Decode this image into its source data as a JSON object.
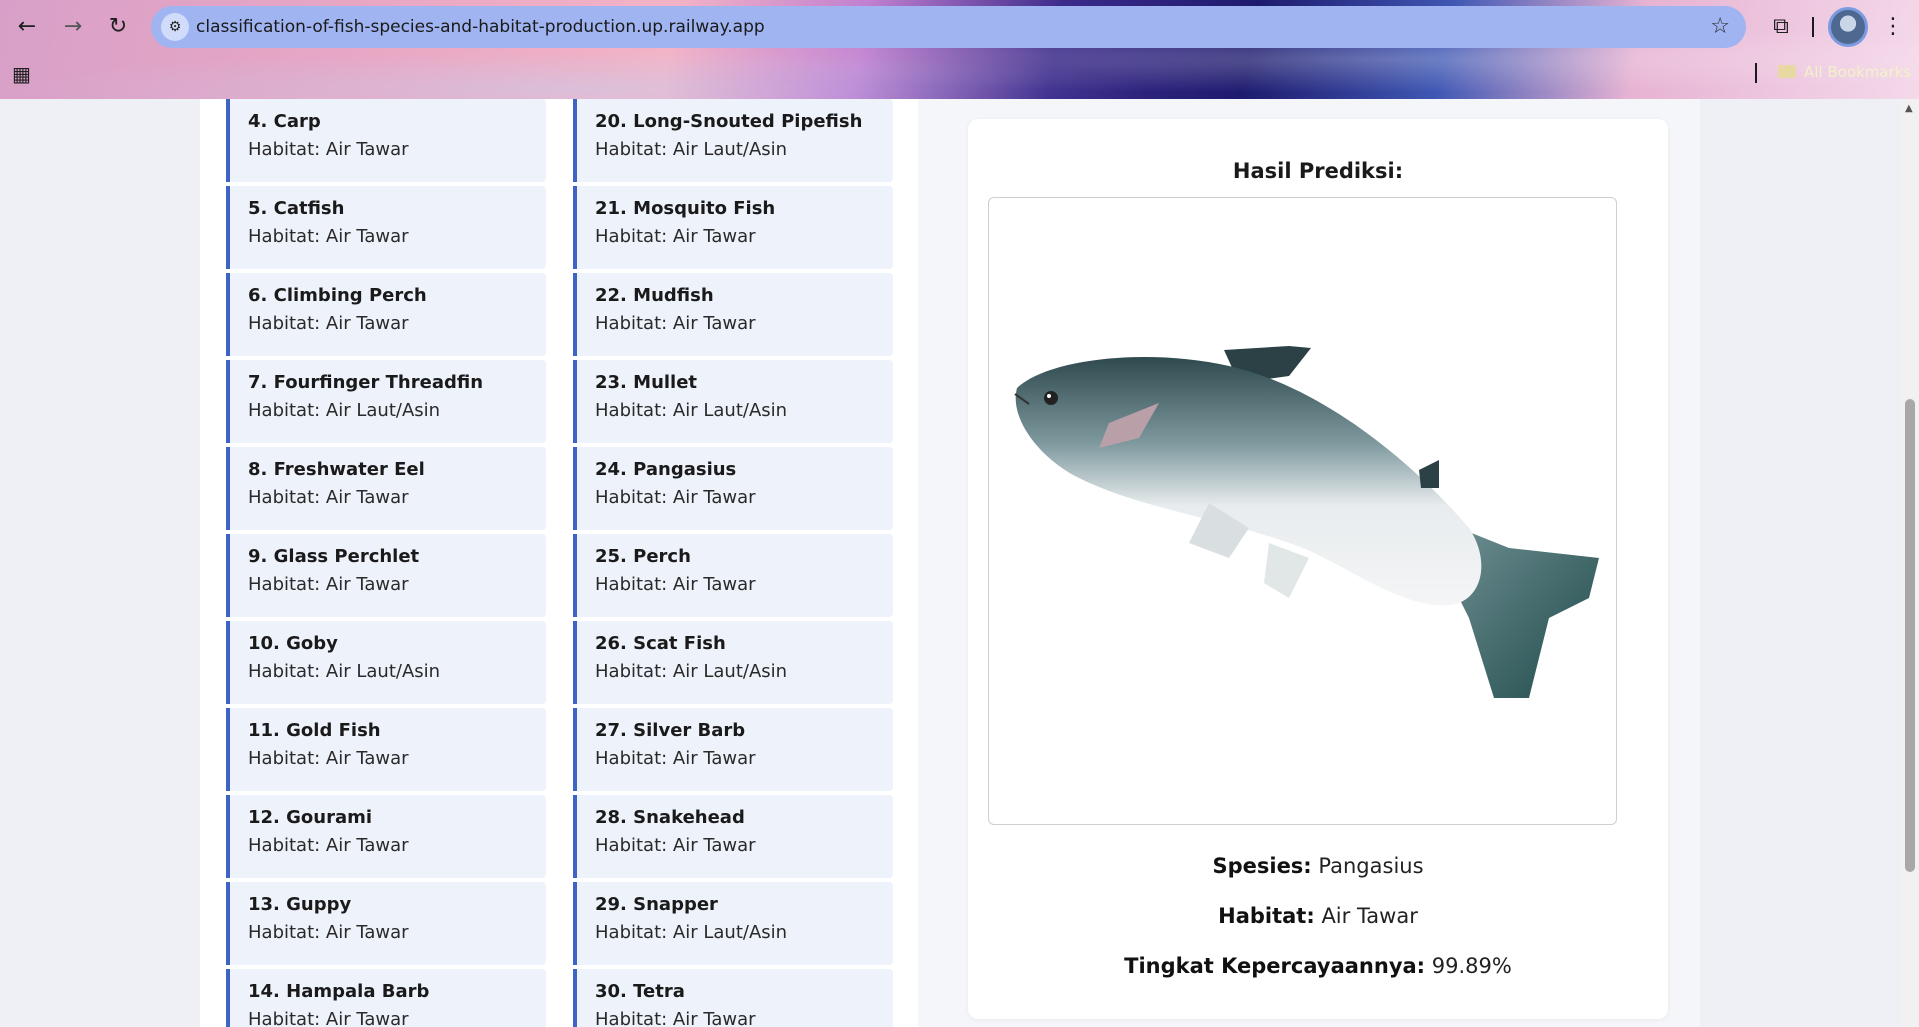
{
  "browser": {
    "url": "classification-of-fish-species-and-habitat-production.up.railway.app",
    "bookmarks_label": "All Bookmarks"
  },
  "fish_list": {
    "col_a": [
      {
        "name": "4. Carp",
        "habitat": "Habitat: Air Tawar"
      },
      {
        "name": "5. Catfish",
        "habitat": "Habitat: Air Tawar"
      },
      {
        "name": "6. Climbing Perch",
        "habitat": "Habitat: Air Tawar"
      },
      {
        "name": "7. Fourfinger Threadfin",
        "habitat": "Habitat: Air Laut/Asin"
      },
      {
        "name": "8. Freshwater Eel",
        "habitat": "Habitat: Air Tawar"
      },
      {
        "name": "9. Glass Perchlet",
        "habitat": "Habitat: Air Tawar"
      },
      {
        "name": "10. Goby",
        "habitat": "Habitat: Air Laut/Asin"
      },
      {
        "name": "11. Gold Fish",
        "habitat": "Habitat: Air Tawar"
      },
      {
        "name": "12. Gourami",
        "habitat": "Habitat: Air Tawar"
      },
      {
        "name": "13. Guppy",
        "habitat": "Habitat: Air Tawar"
      },
      {
        "name": "14. Hampala Barb",
        "habitat": "Habitat: Air Tawar"
      }
    ],
    "col_b": [
      {
        "name": "20. Long-Snouted Pipefish",
        "habitat": "Habitat: Air Laut/Asin"
      },
      {
        "name": "21. Mosquito Fish",
        "habitat": "Habitat: Air Tawar"
      },
      {
        "name": "22. Mudfish",
        "habitat": "Habitat: Air Tawar"
      },
      {
        "name": "23. Mullet",
        "habitat": "Habitat: Air Laut/Asin"
      },
      {
        "name": "24. Pangasius",
        "habitat": "Habitat: Air Tawar"
      },
      {
        "name": "25. Perch",
        "habitat": "Habitat: Air Tawar"
      },
      {
        "name": "26. Scat Fish",
        "habitat": "Habitat: Air Laut/Asin"
      },
      {
        "name": "27. Silver Barb",
        "habitat": "Habitat: Air Tawar"
      },
      {
        "name": "28. Snakehead",
        "habitat": "Habitat: Air Tawar"
      },
      {
        "name": "29. Snapper",
        "habitat": "Habitat: Air Laut/Asin"
      },
      {
        "name": "30. Tetra",
        "habitat": "Habitat: Air Tawar"
      }
    ]
  },
  "result": {
    "title": "Hasil Prediksi:",
    "species_label": "Spesies:",
    "species_value": "Pangasius",
    "habitat_label": "Habitat:",
    "habitat_value": "Air Tawar",
    "confidence_label": "Tingkat Kepercayaannya:",
    "confidence_value": "99.89%"
  },
  "colors": {
    "accent": "#3f63c4",
    "item_bg": "#edf2fb"
  }
}
